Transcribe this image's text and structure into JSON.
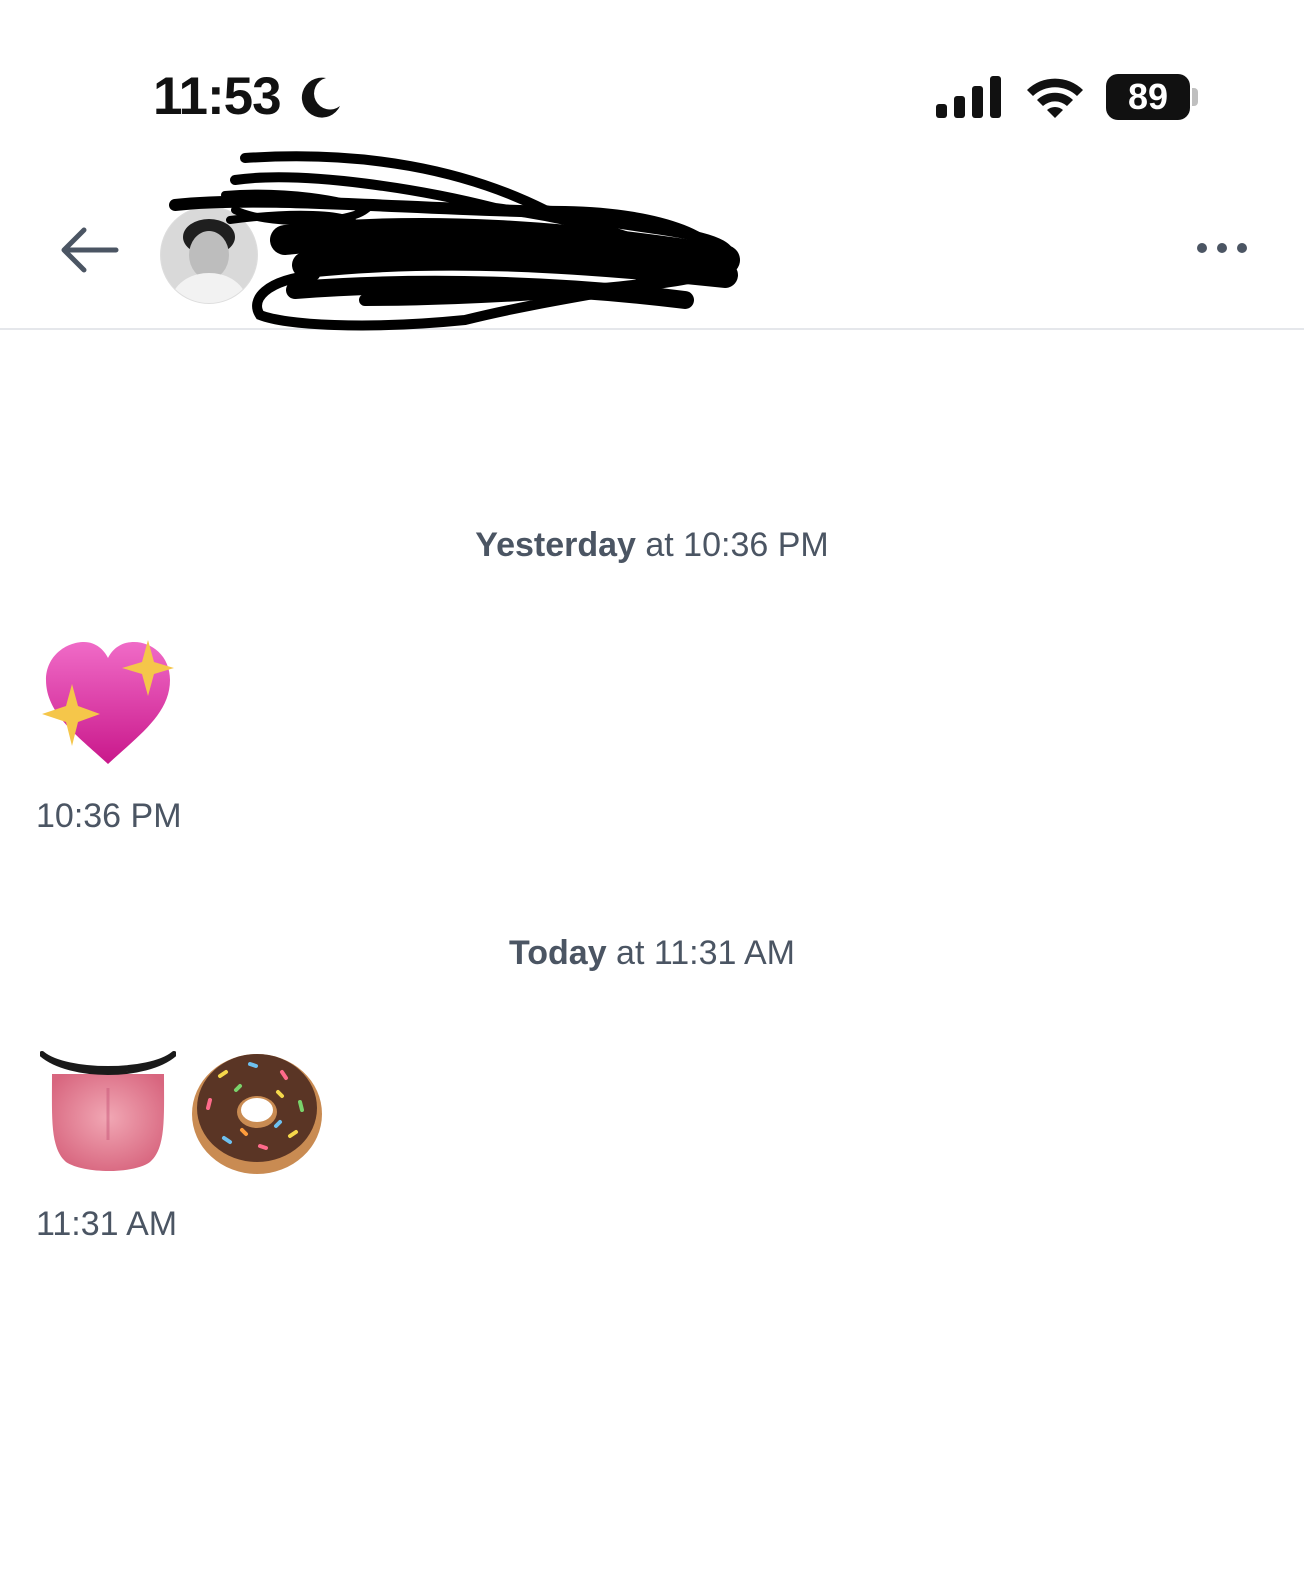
{
  "status_bar": {
    "time": "11:53",
    "battery": "89",
    "icons": [
      "moon-icon",
      "cellular-signal-icon",
      "wifi-icon",
      "battery-icon"
    ]
  },
  "header": {
    "back_icon": "arrow-left-icon",
    "more_icon": "ellipsis-icon"
  },
  "messages": [
    {
      "divider_day": "Yesterday",
      "divider_rest": " at 10:36 PM",
      "emoji": "sparkling-heart",
      "time": "10:36 PM"
    },
    {
      "divider_day": "Today",
      "divider_rest": " at 11:31 AM",
      "emoji": [
        "tongue",
        "doughnut"
      ],
      "time": "11:31 AM"
    }
  ],
  "colors": {
    "text_secondary": "#4b5563",
    "divider": "#e5e7eb",
    "icon": "#4b5563"
  }
}
